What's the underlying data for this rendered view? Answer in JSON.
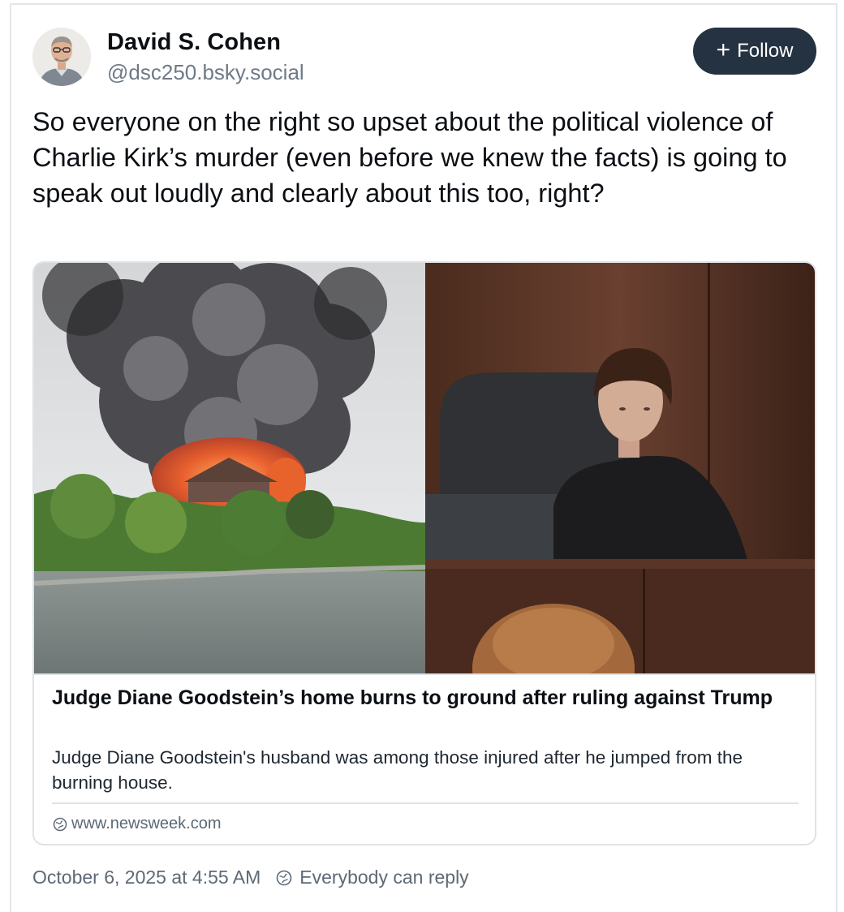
{
  "author": {
    "display_name": "David S. Cohen",
    "handle": "@dsc250.bsky.social",
    "avatar_icon": "person-portrait-icon"
  },
  "follow_button": {
    "label": "Follow",
    "icon": "plus-icon"
  },
  "post": {
    "text": "So everyone on the right so upset about the political violence of Charlie Kirk’s murder (even before we knew the facts) is going to speak out loudly and clearly about this too, right?"
  },
  "link_card": {
    "image_icon": "news-photo-collage",
    "title": "Judge Diane Goodstein’s home burns to ground after ruling against Trump",
    "description": "Judge Diane Goodstein's husband was among those injured after he jumped from the burning house.",
    "domain": "www.newsweek.com",
    "domain_icon": "globe-icon"
  },
  "footer": {
    "timestamp": "October 6, 2025 at 4:55 AM",
    "reply_setting": "Everybody can reply",
    "reply_icon": "globe-icon"
  },
  "colors": {
    "follow_bg": "#253241",
    "muted_text": "#6e7a88",
    "border": "#dfe3e7"
  }
}
